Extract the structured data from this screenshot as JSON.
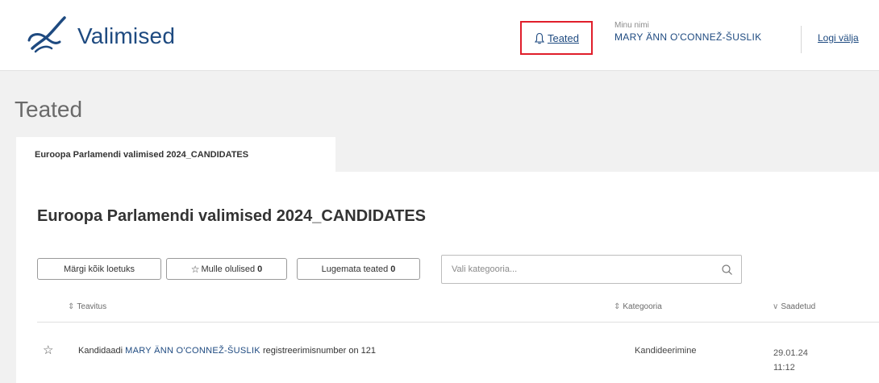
{
  "header": {
    "logo_text": "Valimised",
    "notifications_label": "Teated",
    "user_label": "Minu nimi",
    "user_name": "MARY ÄNN O'CONNEŽ-ŠUSLIK",
    "logout_label": "Logi välja"
  },
  "page": {
    "title": "Teated",
    "tab_label": "Euroopa Parlamendi valimised 2024_CANDIDATES",
    "section_title": "Euroopa Parlamendi valimised 2024_CANDIDATES"
  },
  "toolbar": {
    "mark_all_read": "Märgi kõik loetuks",
    "important_label": "Mulle olulised",
    "important_count": "0",
    "unread_label": "Lugemata teated",
    "unread_count": "0",
    "category_placeholder": "Vali kategooria..."
  },
  "table": {
    "columns": {
      "notification": "Teavitus",
      "category": "Kategooria",
      "sent": "Saadetud"
    },
    "rows": [
      {
        "prefix": "Kandidaadi",
        "name": "MARY ÄNN O'CONNEŽ-ŠUSLIK",
        "suffix": "registreerimisnumber on 121",
        "category": "Kandideerimine",
        "date": "29.01.24",
        "time": "11:12"
      }
    ]
  },
  "colors": {
    "brand": "#1e4a80",
    "highlight_border": "#e01e2b",
    "background": "#f1f1f1"
  },
  "icons": {
    "logo": "ballot-check-logo",
    "notifications": "bell-icon",
    "search": "search-icon",
    "star": "star-icon",
    "sort": "sort-icon"
  }
}
